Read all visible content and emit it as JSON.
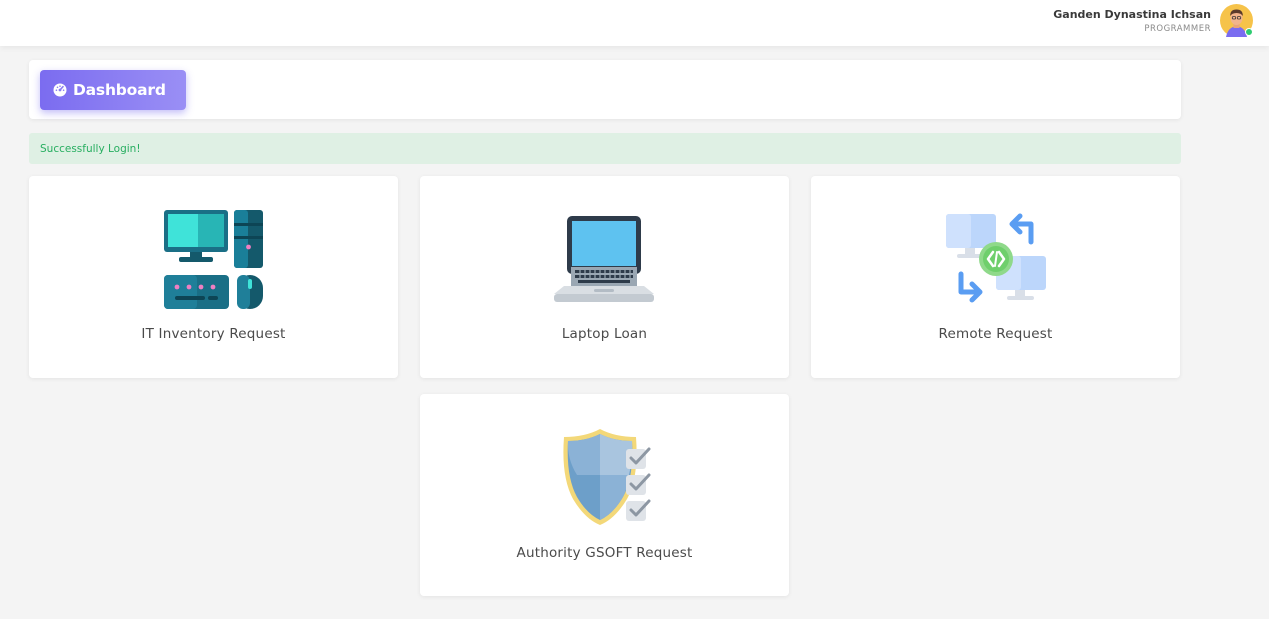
{
  "user": {
    "name": "Ganden Dynastina Ichsan",
    "role": "PROGRAMMER"
  },
  "header": {
    "dashboard_label": "Dashboard"
  },
  "alert": {
    "message": "Successfully Login!"
  },
  "menu": [
    {
      "label": "IT Inventory Request",
      "icon": "computer-set-icon"
    },
    {
      "label": "Laptop Loan",
      "icon": "laptop-icon"
    },
    {
      "label": "Remote Request",
      "icon": "remote-connection-icon"
    },
    {
      "label": "Authority GSOFT Request",
      "icon": "shield-checklist-icon"
    }
  ],
  "colors": {
    "accent": "#7b6cf0",
    "success_bg": "#dff0e4",
    "success_text": "#27ae60"
  }
}
